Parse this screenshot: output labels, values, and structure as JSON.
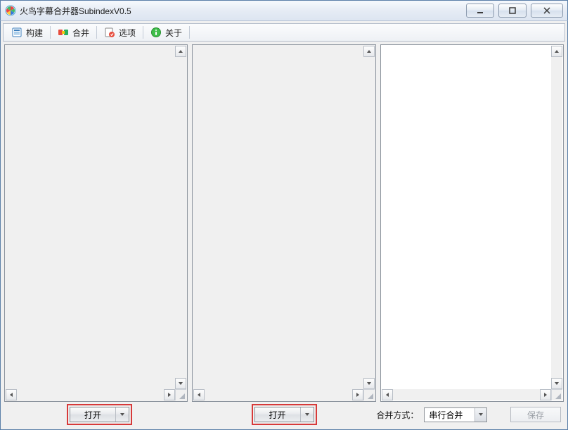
{
  "window": {
    "title": "火鸟字幕合并器SubindexV0.5"
  },
  "toolbar": {
    "build": "构建",
    "merge": "合并",
    "options": "选项",
    "about": "关于"
  },
  "buttons": {
    "open": "打开",
    "save": "保存"
  },
  "merge_mode": {
    "label": "合并方式：",
    "selected": "串行合并"
  }
}
